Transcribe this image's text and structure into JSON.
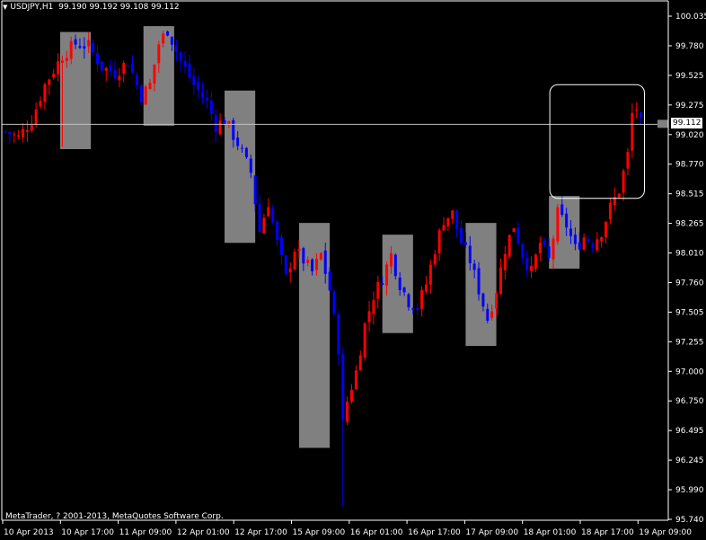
{
  "header": {
    "symbol": "USDJPY,H1",
    "quote": "99.190 99.192 99.108 99.112"
  },
  "copyright": "MetaTrader, ? 2001-2013, MetaQuotes Software Corp.",
  "current_price_label": "99.112",
  "colors": {
    "background": "#000000",
    "bull_candle": "#ff0000",
    "bear_candle": "#0000ff",
    "zone_fill": "#808080",
    "axis": "#ffffff",
    "price_line": "#c0c0c0"
  },
  "chart_data": {
    "type": "candlestick",
    "title": "USDJPY,H1",
    "y_tick_labels": [
      "100.035",
      "99.780",
      "99.525",
      "99.275",
      "99.020",
      "98.770",
      "98.515",
      "98.265",
      "98.010",
      "97.760",
      "97.505",
      "97.255",
      "97.000",
      "96.750",
      "96.495",
      "96.245",
      "95.990",
      "95.740"
    ],
    "y_range": [
      95.74,
      100.035
    ],
    "x_tick_labels": [
      "10 Apr 2013",
      "10 Apr 17:00",
      "11 Apr 09:00",
      "12 Apr 01:00",
      "12 Apr 17:00",
      "15 Apr 09:00",
      "16 Apr 01:00",
      "16 Apr 17:00",
      "17 Apr 09:00",
      "18 Apr 01:00",
      "18 Apr 17:00",
      "19 Apr 09:00"
    ],
    "current_price": 99.112,
    "close_path": [
      {
        "t": 0,
        "c": 99.05
      },
      {
        "t": 3,
        "c": 99.0
      },
      {
        "t": 6,
        "c": 99.15
      },
      {
        "t": 9,
        "c": 99.45
      },
      {
        "t": 13,
        "c": 99.7
      },
      {
        "t": 16,
        "c": 99.8
      },
      {
        "t": 19,
        "c": 99.78
      },
      {
        "t": 22,
        "c": 99.6
      },
      {
        "t": 25,
        "c": 99.55
      },
      {
        "t": 28,
        "c": 99.65
      },
      {
        "t": 31,
        "c": 99.35
      },
      {
        "t": 33,
        "c": 99.45
      },
      {
        "t": 35,
        "c": 99.8
      },
      {
        "t": 37,
        "c": 99.92
      },
      {
        "t": 40,
        "c": 99.65
      },
      {
        "t": 43,
        "c": 99.45
      },
      {
        "t": 46,
        "c": 99.3
      },
      {
        "t": 48,
        "c": 99.1
      },
      {
        "t": 50,
        "c": 99.15
      },
      {
        "t": 53,
        "c": 98.95
      },
      {
        "t": 56,
        "c": 98.7
      },
      {
        "t": 58,
        "c": 98.2
      },
      {
        "t": 60,
        "c": 98.45
      },
      {
        "t": 62,
        "c": 98.1
      },
      {
        "t": 64,
        "c": 97.8
      },
      {
        "t": 66,
        "c": 98.05
      },
      {
        "t": 68,
        "c": 97.95
      },
      {
        "t": 70,
        "c": 97.85
      },
      {
        "t": 72,
        "c": 98.0
      },
      {
        "t": 74,
        "c": 97.7
      },
      {
        "t": 76,
        "c": 97.2
      },
      {
        "t": 77,
        "c": 96.55
      },
      {
        "t": 78,
        "c": 96.75
      },
      {
        "t": 80,
        "c": 97.0
      },
      {
        "t": 82,
        "c": 97.4
      },
      {
        "t": 84,
        "c": 97.65
      },
      {
        "t": 86,
        "c": 97.8
      },
      {
        "t": 88,
        "c": 98.0
      },
      {
        "t": 90,
        "c": 97.75
      },
      {
        "t": 92,
        "c": 97.6
      },
      {
        "t": 94,
        "c": 97.55
      },
      {
        "t": 96,
        "c": 97.75
      },
      {
        "t": 98,
        "c": 98.05
      },
      {
        "t": 100,
        "c": 98.3
      },
      {
        "t": 102,
        "c": 98.35
      },
      {
        "t": 104,
        "c": 98.1
      },
      {
        "t": 106,
        "c": 97.95
      },
      {
        "t": 108,
        "c": 97.7
      },
      {
        "t": 110,
        "c": 97.45
      },
      {
        "t": 112,
        "c": 97.7
      },
      {
        "t": 114,
        "c": 98.05
      },
      {
        "t": 116,
        "c": 98.25
      },
      {
        "t": 118,
        "c": 98.0
      },
      {
        "t": 120,
        "c": 97.85
      },
      {
        "t": 122,
        "c": 98.1
      },
      {
        "t": 124,
        "c": 97.95
      },
      {
        "t": 126,
        "c": 98.35
      },
      {
        "t": 128,
        "c": 98.25
      },
      {
        "t": 130,
        "c": 98.05
      },
      {
        "t": 132,
        "c": 98.15
      },
      {
        "t": 134,
        "c": 98.1
      },
      {
        "t": 136,
        "c": 98.2
      },
      {
        "t": 138,
        "c": 98.4
      },
      {
        "t": 140,
        "c": 98.55
      },
      {
        "t": 142,
        "c": 98.85
      },
      {
        "t": 143,
        "c": 99.2
      },
      {
        "t": 144,
        "c": 99.25
      },
      {
        "t": 145,
        "c": 99.11
      }
    ],
    "highlight_zones": [
      {
        "t0": 12.5,
        "t1": 19.5,
        "high": 99.9,
        "low": 98.9
      },
      {
        "t0": 31.5,
        "t1": 38.5,
        "high": 99.95,
        "low": 99.1
      },
      {
        "t0": 50,
        "t1": 57,
        "high": 99.4,
        "low": 98.1
      },
      {
        "t0": 67,
        "t1": 74,
        "high": 98.27,
        "low": 96.35
      },
      {
        "t0": 86,
        "t1": 93,
        "high": 98.17,
        "low": 97.33
      },
      {
        "t0": 105,
        "t1": 112,
        "high": 98.27,
        "low": 97.22
      },
      {
        "t0": 124,
        "t1": 131,
        "high": 98.5,
        "low": 97.88
      }
    ],
    "rounded_box": {
      "t0": 124,
      "t1": 146,
      "high": 99.45,
      "low": 98.48
    }
  }
}
